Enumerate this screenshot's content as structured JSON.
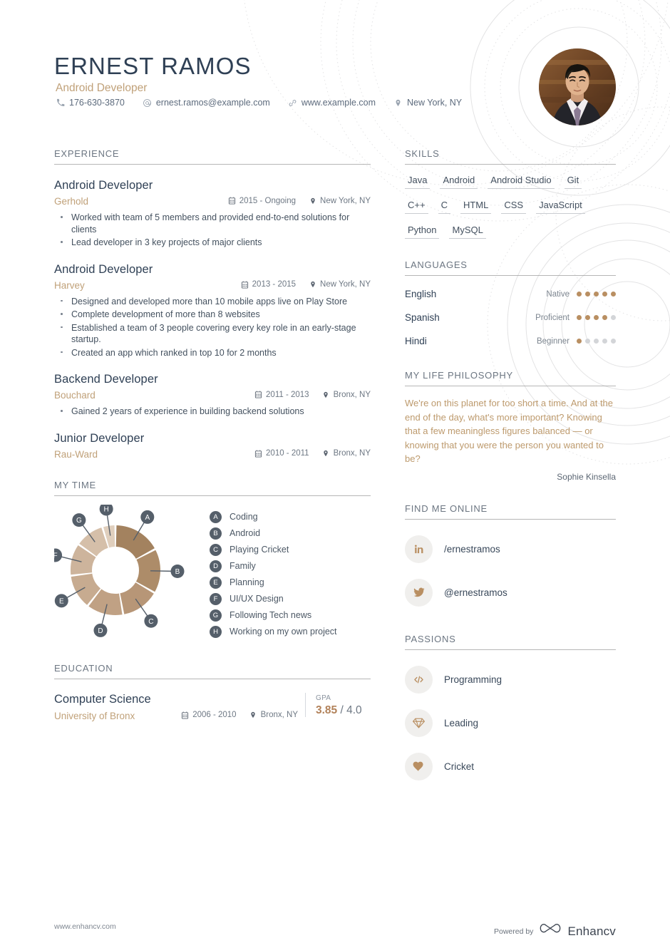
{
  "header": {
    "name": "ERNEST RAMOS",
    "role": "Android Developer",
    "contacts": [
      {
        "icon": "phone-icon",
        "text": "176-630-3870"
      },
      {
        "icon": "email-icon",
        "text": "ernest.ramos@example.com"
      },
      {
        "icon": "link-icon",
        "text": "www.example.com"
      },
      {
        "icon": "location-icon",
        "text": "New York, NY"
      }
    ]
  },
  "experience": {
    "title": "EXPERIENCE",
    "jobs": [
      {
        "title": "Android Developer",
        "company": "Gerhold",
        "dates": "2015 - Ongoing",
        "location": "New York, NY",
        "bullets": [
          "Worked with team of 5 members and provided end-to-end solutions for clients",
          "Lead developer in 3 key projects of major clients"
        ]
      },
      {
        "title": "Android Developer",
        "company": "Harvey",
        "dates": "2013 - 2015",
        "location": "New York, NY",
        "bullets": [
          "Designed and developed more than 10 mobile apps live on Play Store",
          "Complete development of more than 8 websites",
          "Established a team of 3 people covering every key role in an early-stage startup.",
          "Created an app which ranked in top 10 for 2 months"
        ]
      },
      {
        "title": "Backend Developer",
        "company": "Bouchard",
        "dates": "2011 - 2013",
        "location": "Bronx, NY",
        "bullets": [
          "Gained 2 years of experience in building backend solutions"
        ]
      },
      {
        "title": "Junior Developer",
        "company": "Rau-Ward",
        "dates": "2010 - 2011",
        "location": "Bronx, NY",
        "bullets": []
      }
    ]
  },
  "mytime": {
    "title": "MY TIME",
    "chart_data": {
      "type": "pie",
      "title": "MY TIME",
      "categories": [
        "Coding",
        "Android",
        "Playing Cricket",
        "Family",
        "Planning",
        "UI/UX Design",
        "Following Tech news",
        "Working on my own project"
      ],
      "labels": [
        "A",
        "B",
        "C",
        "D",
        "E",
        "F",
        "G",
        "H"
      ],
      "values": [
        62,
        58,
        50,
        48,
        45,
        42,
        38,
        17
      ],
      "unit": "degrees",
      "colors": [
        "#a3825f",
        "#ad8c69",
        "#b79677",
        "#c0a184",
        "#c7ab90",
        "#cdb49c",
        "#d5bfa9",
        "#e0cfbd"
      ],
      "legend": "right",
      "donut_hole": true
    }
  },
  "education": {
    "title": "EDUCATION",
    "degree": "Computer Science",
    "school": "University of Bronx",
    "dates": "2006 - 2010",
    "location": "Bronx, NY",
    "gpa_label": "GPA",
    "gpa_value": "3.85",
    "gpa_scale": "/ 4.0"
  },
  "skills": {
    "title": "SKILLS",
    "items": [
      "Java",
      "Android",
      "Android Studio",
      "Git",
      "C++",
      "C",
      "HTML",
      "CSS",
      "JavaScript",
      "Python",
      "MySQL"
    ]
  },
  "languages": {
    "title": "LANGUAGES",
    "items": [
      {
        "name": "English",
        "level": "Native",
        "rating": 5,
        "max": 5
      },
      {
        "name": "Spanish",
        "level": "Proficient",
        "rating": 4,
        "max": 5
      },
      {
        "name": "Hindi",
        "level": "Beginner",
        "rating": 1,
        "max": 5
      }
    ]
  },
  "philosophy": {
    "title": "MY LIFE PHILOSOPHY",
    "quote": "We're on this planet for too short a time. And at the end of the day, what's more important? Knowing that a few meaningless figures balanced — or knowing that you were the person you wanted to be?",
    "author": "Sophie Kinsella"
  },
  "online": {
    "title": "FIND ME ONLINE",
    "items": [
      {
        "icon": "linkedin-icon",
        "handle": "/ernestramos"
      },
      {
        "icon": "twitter-icon",
        "handle": "@ernestramos"
      }
    ]
  },
  "passions": {
    "title": "PASSIONS",
    "items": [
      {
        "icon": "code-icon",
        "label": "Programming"
      },
      {
        "icon": "diamond-icon",
        "label": "Leading"
      },
      {
        "icon": "heart-icon",
        "label": "Cricket"
      }
    ]
  },
  "footer": {
    "url": "www.enhancv.com",
    "powered_by": "Powered by",
    "brand": "Enhancv"
  },
  "colors": {
    "accent_tan": "#bd9a6d",
    "heading_navy": "#2f4055",
    "body_gray": "#44515f",
    "rule_gray": "#9a9a9a"
  }
}
